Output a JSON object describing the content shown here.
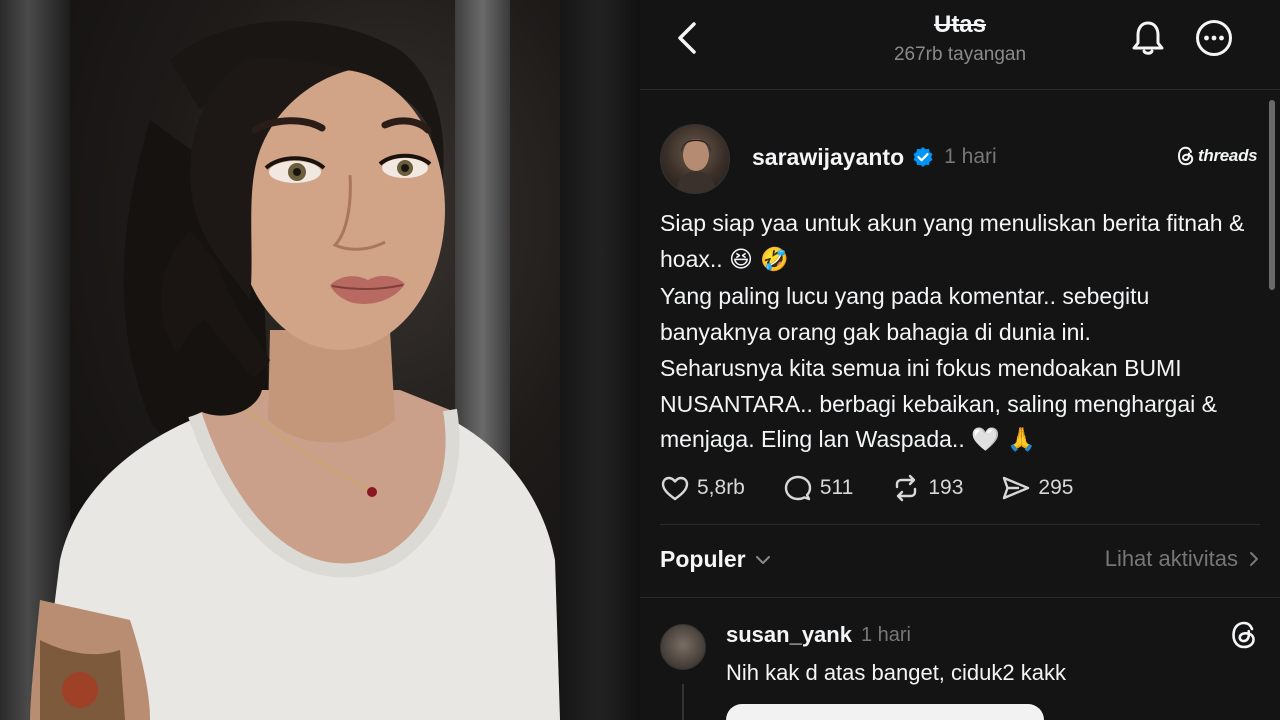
{
  "header": {
    "title": "Utas",
    "subtitle": "267rb tayangan",
    "icons": [
      "back-arrow-icon",
      "bell-icon",
      "more-icon"
    ]
  },
  "post": {
    "username": "sarawijayanto",
    "time": "1 hari",
    "threads_brand": "threads",
    "paragraphs": [
      "Siap siap yaa untuk akun yang menuliskan berita fitnah & hoax..",
      "Yang paling lucu yang pada komentar.. sebegitu banyaknya orang gak bahagia di dunia ini.",
      "Seharusnya kita semua ini fokus mendoakan BUMI NUSANTARA.. berbagi kebaikan, saling menghargai & menjaga. Eling lan Waspada.."
    ],
    "emoji_1": "😆 🤣",
    "emoji_2": "🤍 🙏",
    "stats": {
      "likes": "5,8rb",
      "comments": "511",
      "reposts": "193",
      "shares": "295"
    }
  },
  "sort": {
    "label": "Populer",
    "activity": "Lihat aktivitas"
  },
  "reply": {
    "username": "susan_yank",
    "time": "1 hari",
    "text": "Nih kak d atas banget, ciduk2 kakk"
  },
  "colors": {
    "background": "#141414",
    "text": "#f3f5f7",
    "muted": "#777777",
    "verified": "#0095f6"
  }
}
